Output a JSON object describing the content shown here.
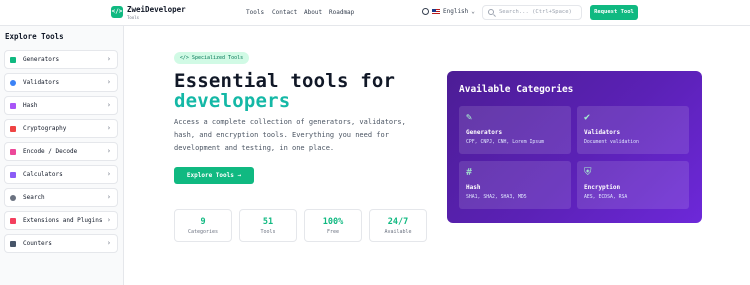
{
  "header": {
    "brand": "ZweiDeveloper",
    "brand_sub": "Tools",
    "logo_glyph": "</>",
    "nav": [
      "Tools",
      "Contact",
      "About",
      "Roadmap"
    ],
    "language": "English",
    "search_placeholder": "Search... (Ctrl+Space)",
    "request_button": "Request Tool"
  },
  "sidebar": {
    "title": "Explore Tools",
    "items": [
      {
        "label": "Generators",
        "icon": "wand-icon",
        "color": "#10b981"
      },
      {
        "label": "Validators",
        "icon": "check-circle-icon",
        "color": "#3b82f6"
      },
      {
        "label": "Hash",
        "icon": "hash-icon",
        "color": "#a855f7"
      },
      {
        "label": "Cryptography",
        "icon": "shield-icon",
        "color": "#ef4444"
      },
      {
        "label": "Encode / Decode",
        "icon": "code-icon",
        "color": "#ec4899"
      },
      {
        "label": "Calculators",
        "icon": "calculator-icon",
        "color": "#8b5cf6"
      },
      {
        "label": "Search",
        "icon": "search-icon",
        "color": "#6b7280"
      },
      {
        "label": "Extensions and Plugins",
        "icon": "puzzle-icon",
        "color": "#f43f5e"
      },
      {
        "label": "Counters",
        "icon": "counter-icon",
        "color": "#475569"
      }
    ]
  },
  "hero": {
    "badge": "</> Specialized Tools",
    "title_line1": "Essential tools for",
    "title_line2": "developers",
    "description": "Access a complete collection of generators, validators, hash, and encryption tools. Everything you need for development and testing, in one place.",
    "cta": "Explore Tools →"
  },
  "stats": [
    {
      "value": "9",
      "label": "Categories"
    },
    {
      "value": "51",
      "label": "Tools"
    },
    {
      "value": "100%",
      "label": "Free"
    },
    {
      "value": "24/7",
      "label": "Available"
    }
  ],
  "categories_panel": {
    "title": "Available Categories",
    "items": [
      {
        "name": "Generators",
        "desc": "CPF, CNPJ, CNH, Lorem Ipsum",
        "icon": "wand-icon"
      },
      {
        "name": "Validators",
        "desc": "Document validation",
        "icon": "check-circle-icon"
      },
      {
        "name": "Hash",
        "desc": "SHA1, SHA2, SHA3, MD5",
        "icon": "hash-icon"
      },
      {
        "name": "Encryption",
        "desc": "AES, ECDSA, RSA",
        "icon": "shield-icon"
      }
    ]
  },
  "colors": {
    "accent": "#10b981",
    "teal": "#14b8a6",
    "panel": "#5b21b6"
  }
}
